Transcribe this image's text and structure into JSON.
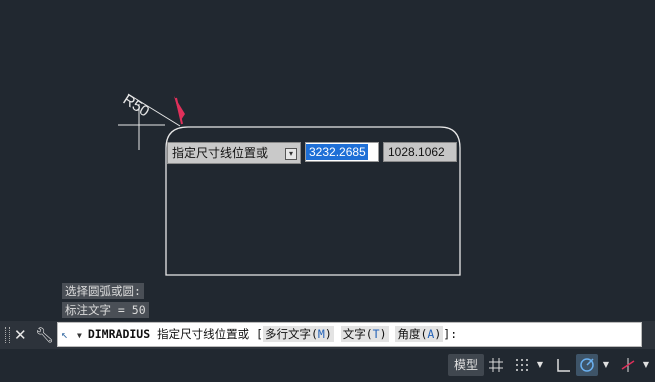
{
  "drawing": {
    "radius_label": "R50",
    "prompt_text": "指定尺寸线位置或",
    "coord_x": "3232.2685",
    "coord_y": "1028.1062",
    "colors": {
      "background": "#212830",
      "geometry": "#e8e8e8",
      "cursor_arrow": "#e0305a"
    }
  },
  "history": {
    "line1": "选择圆弧或圆:",
    "line2": "标注文字 = 50"
  },
  "command_line": {
    "command": "DIMRADIUS",
    "prompt": "指定尺寸线位置或",
    "open_bracket": "[",
    "options": [
      {
        "label": "多行文字",
        "key": "M"
      },
      {
        "label": "文字",
        "key": "T"
      },
      {
        "label": "角度",
        "key": "A"
      }
    ],
    "close": "]:"
  },
  "status_bar": {
    "model_label": "模型",
    "icons": [
      "grid-icon",
      "snap-icon",
      "ortho-icon",
      "polar-icon",
      "osnap-icon"
    ]
  }
}
